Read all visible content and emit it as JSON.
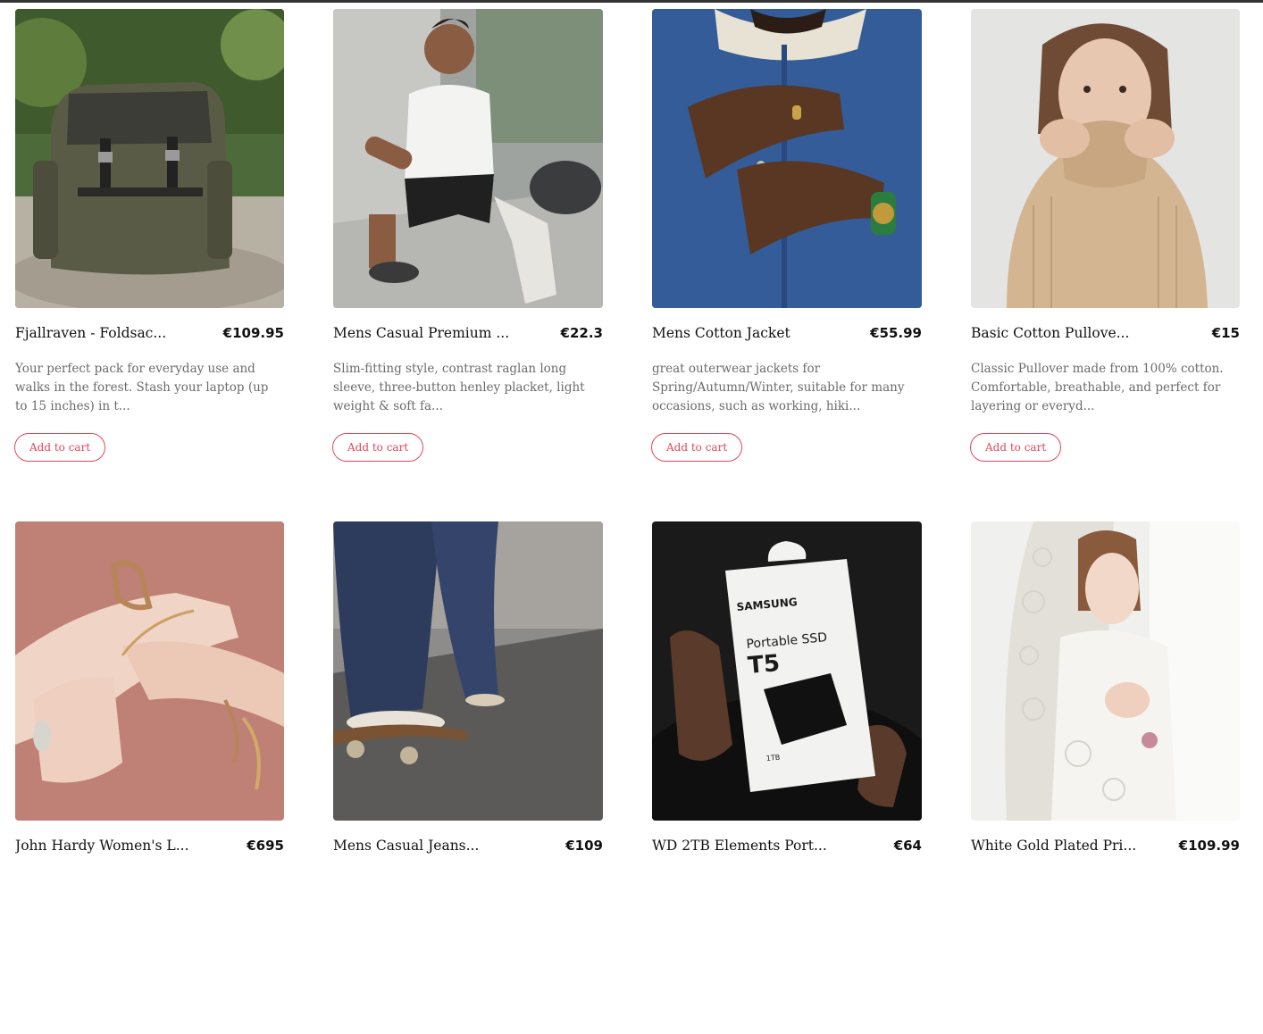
{
  "accent_color": "#e0485b",
  "products": [
    {
      "title": "Fjallraven - Foldsac...",
      "price": "€109.95",
      "description": "Your perfect pack for everyday use and walks in the forest. Stash your laptop (up to 15 inches) in t...",
      "button": "Add to cart",
      "image_icon": "backpack-photo"
    },
    {
      "title": "Mens Casual Premium ...",
      "price": "€22.3",
      "description": "Slim-fitting style, contrast raglan long sleeve, three-button henley placket, light weight & soft fa...",
      "button": "Add to cart",
      "image_icon": "man-tshirt-photo"
    },
    {
      "title": "Mens Cotton Jacket",
      "price": "€55.99",
      "description": "great outerwear jackets for Spring/Autumn/Winter, suitable for many occasions, such as working, hiki...",
      "button": "Add to cart",
      "image_icon": "denim-jacket-photo"
    },
    {
      "title": "Basic Cotton Pullove...",
      "price": "€15",
      "description": "Classic Pullover made from 100% cotton. Comfortable, breathable, and perfect for layering or everyd...",
      "button": "Add to cart",
      "image_icon": "woman-pullover-photo"
    },
    {
      "title": "John Hardy Women's L...",
      "price": "€695",
      "description": "",
      "button": "",
      "image_icon": "bracelet-hands-photo"
    },
    {
      "title": "Mens Casual Jeans...",
      "price": "€109",
      "description": "",
      "button": "",
      "image_icon": "jeans-skateboard-photo"
    },
    {
      "title": "WD 2TB Elements Port...",
      "price": "€64",
      "description": "",
      "button": "",
      "image_icon": "portable-ssd-photo"
    },
    {
      "title": "White Gold Plated Pri...",
      "price": "€109.99",
      "description": "",
      "button": "",
      "image_icon": "bride-veil-photo"
    }
  ],
  "ssd_box": {
    "brand": "SAMSUNG",
    "line1": "Portable SSD",
    "model": "T5",
    "capacity": "1TB"
  }
}
